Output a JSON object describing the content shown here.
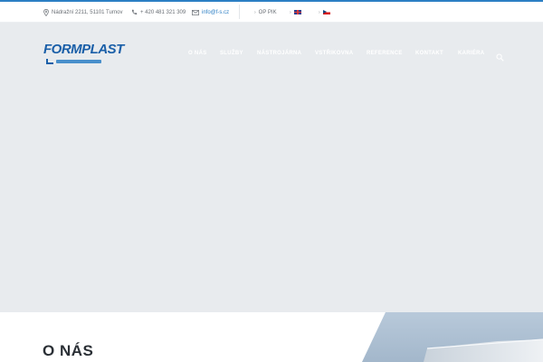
{
  "topbar": {
    "address": "Nádražní 2211, 51101 Turnov",
    "address_icon": "location-pin-icon",
    "phone": "+ 420 481 321 309",
    "phone_icon": "phone-icon",
    "email": "info@f-s.cz",
    "email_icon": "envelope-icon",
    "op_pik": "OP PIK",
    "languages": [
      {
        "code": "en",
        "icon": "uk-flag-icon"
      },
      {
        "code": "cs",
        "icon": "czech-flag-icon"
      }
    ]
  },
  "colors": {
    "accent": "#2c7fc4",
    "logo": "#1a5fa8",
    "hero_background": "#e8ebee",
    "heading": "#2a2f35"
  },
  "logo": {
    "text": "FORMPLAST"
  },
  "nav": {
    "items": [
      {
        "label": "O NÁS"
      },
      {
        "label": "SLUŽBY"
      },
      {
        "label": "NÁSTROJÁRNA"
      },
      {
        "label": "VSTŘIKOVNA"
      },
      {
        "label": "REFERENCE"
      },
      {
        "label": "KONTAKT"
      },
      {
        "label": "KARIÉRA"
      }
    ],
    "search_icon": "search-icon"
  },
  "about": {
    "title": "O NÁS"
  }
}
